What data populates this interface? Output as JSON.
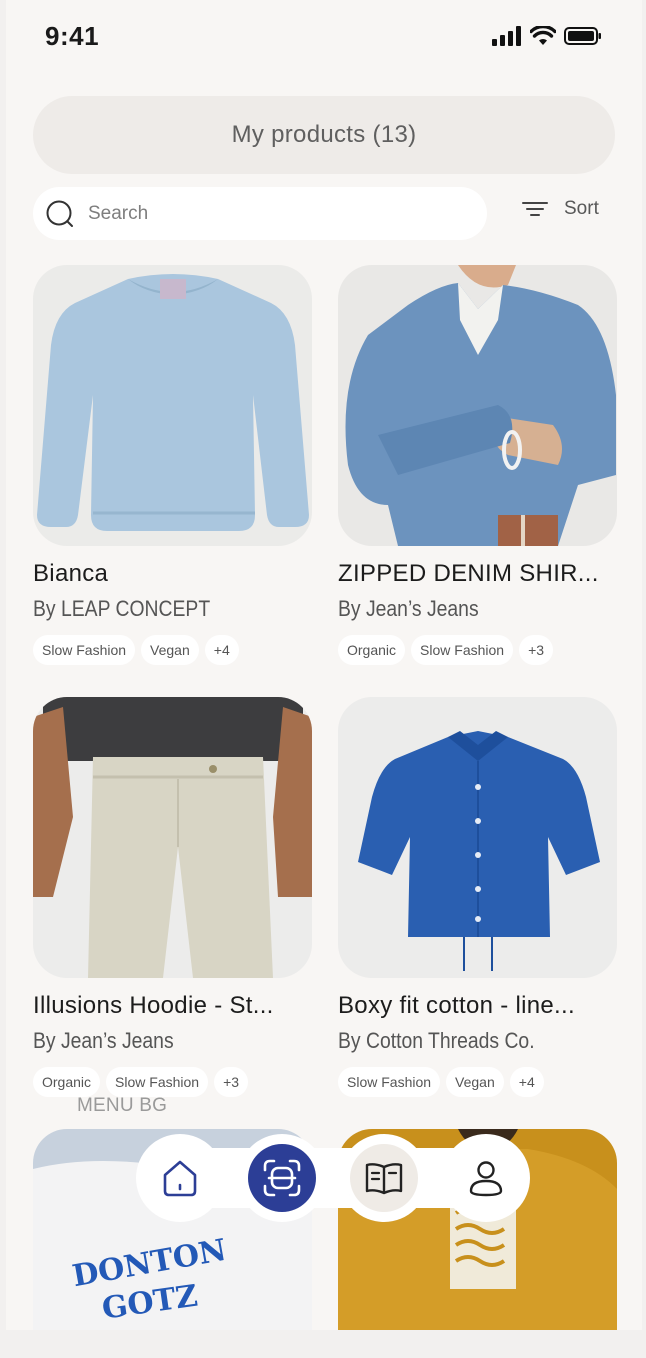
{
  "status_bar": {
    "time": "9:41"
  },
  "header": {
    "title": "My products (13)"
  },
  "search": {
    "placeholder": "Search"
  },
  "sort": {
    "label": "Sort"
  },
  "products": [
    {
      "title": "Bianca",
      "brand": "By LEAP CONCEPT",
      "tags": [
        "Slow Fashion",
        "Vegan",
        "+4"
      ],
      "image": "light blue sweater"
    },
    {
      "title": "ZIPPED DENIM SHIR...",
      "brand": "By Jean’s Jeans",
      "tags": [
        "Organic",
        "Slow Fashion",
        "+3"
      ],
      "image": "denim shirt on model"
    },
    {
      "title": "Illusions Hoodie - St...",
      "brand": "By Jean’s Jeans",
      "tags": [
        "Organic",
        "Slow Fashion",
        "+3"
      ],
      "image": "beige jeans on model"
    },
    {
      "title": "Boxy fit cotton - line...",
      "brand": "By Cotton Threads Co.",
      "tags": [
        "Slow Fashion",
        "Vegan",
        "+4"
      ],
      "image": "blue shirt"
    }
  ],
  "menu_bg_label": "MENU BG",
  "nav": {
    "items": [
      {
        "icon": "home-icon",
        "active": false
      },
      {
        "icon": "scan-icon",
        "active": true
      },
      {
        "icon": "book-icon",
        "active": false
      },
      {
        "icon": "user-icon",
        "active": false
      }
    ]
  },
  "colors": {
    "accent": "#2c3e96",
    "background": "#f8f6f4",
    "mustard": "#c8901c",
    "denim": "#1f5fae"
  }
}
